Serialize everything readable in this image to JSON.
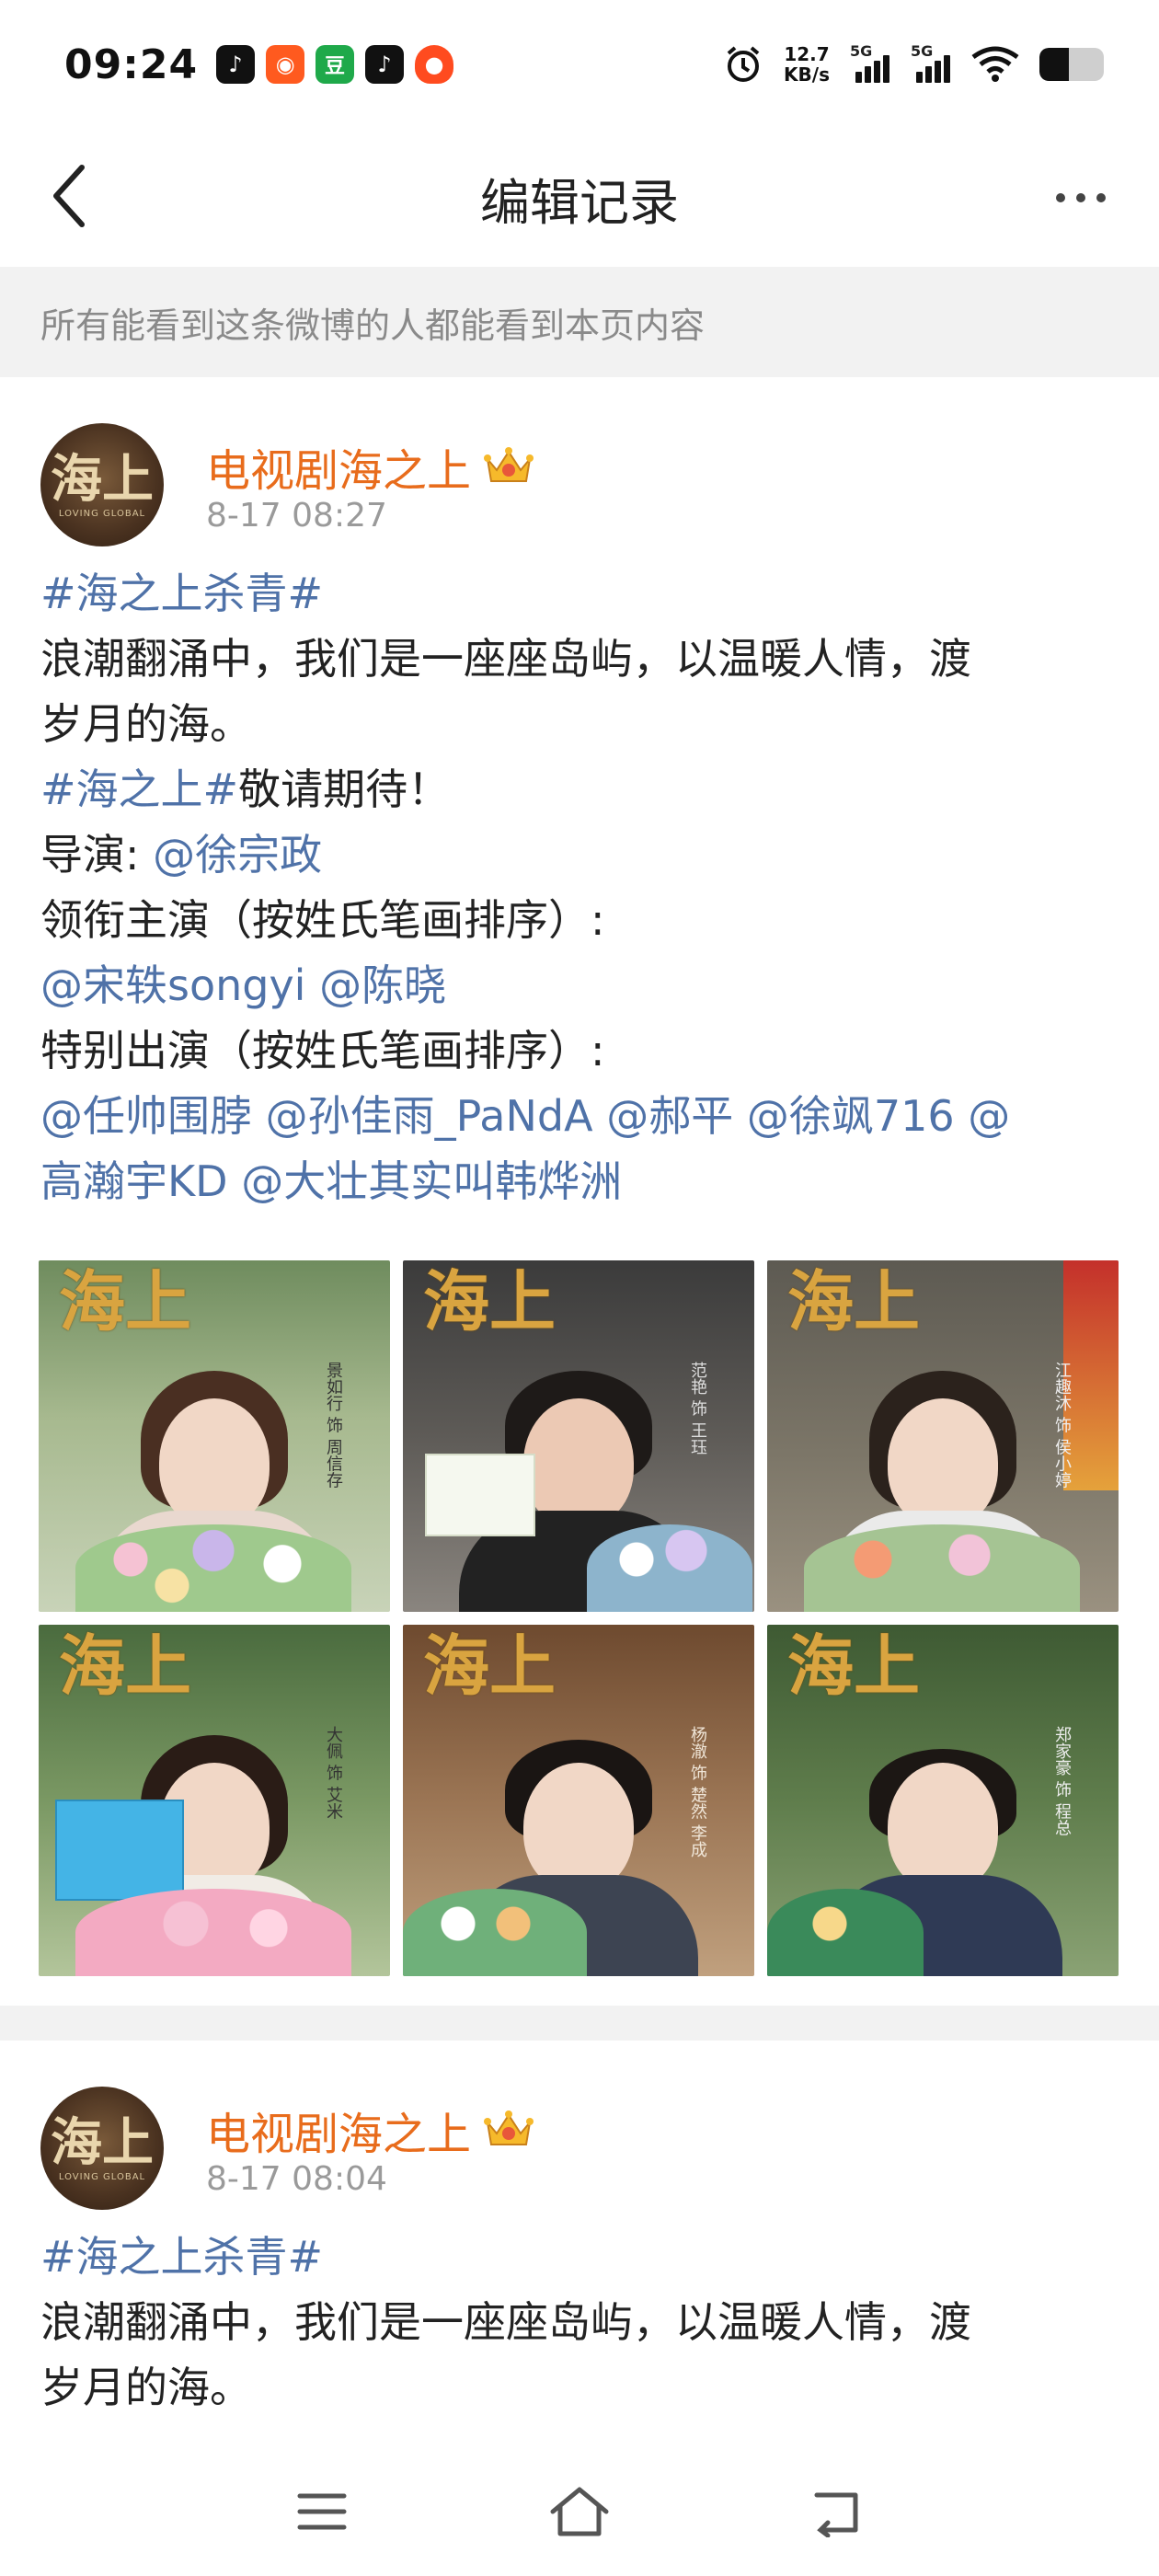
{
  "status_bar": {
    "time": "09:24",
    "net_speed_value": "12.7",
    "net_speed_unit": "KB/s",
    "signal1_label": "5G",
    "signal2_label": "5G",
    "app_icons": [
      "tiktok-lite-icon",
      "kuaishou-icon",
      "douban-icon",
      "tiktok-icon",
      "taobao-icon"
    ],
    "battery_level": 0.45
  },
  "nav": {
    "title": "编辑记录"
  },
  "notice": {
    "text": "所有能看到这条微博的人都能看到本页内容"
  },
  "posts": [
    {
      "author": "电视剧海之上",
      "avatar_text": "海上",
      "avatar_sub": "LOVING GLOBAL",
      "time": "8-17 08:27",
      "lines": [
        [
          {
            "t": "topic",
            "v": "#海之上杀青#"
          }
        ],
        [
          {
            "t": "text",
            "v": "浪潮翻涌中，我们是一座座岛屿，以温暖人情，渡"
          }
        ],
        [
          {
            "t": "text",
            "v": "岁月的海。"
          }
        ],
        [
          {
            "t": "topic",
            "v": "#海之上#"
          },
          {
            "t": "text",
            "v": "敬请期待！"
          }
        ],
        [
          {
            "t": "text",
            "v": "导演: "
          },
          {
            "t": "mention",
            "v": "@徐宗政"
          }
        ],
        [
          {
            "t": "text",
            "v": "领衔主演（按姓氏笔画排序）:"
          }
        ],
        [
          {
            "t": "mention",
            "v": "@宋轶songyi"
          },
          {
            "t": "text",
            "v": " "
          },
          {
            "t": "mention",
            "v": "@陈晓"
          }
        ],
        [
          {
            "t": "text",
            "v": "特别出演（按姓氏笔画排序）:"
          }
        ],
        [
          {
            "t": "mention",
            "v": "@任帅围脖"
          },
          {
            "t": "text",
            "v": " "
          },
          {
            "t": "mention",
            "v": "@孙佳雨_PaNdA"
          },
          {
            "t": "text",
            "v": " "
          },
          {
            "t": "mention",
            "v": "@郝平"
          },
          {
            "t": "text",
            "v": " "
          },
          {
            "t": "mention",
            "v": "@徐飒716"
          },
          {
            "t": "text",
            "v": " "
          },
          {
            "t": "mention",
            "v": "@"
          }
        ],
        [
          {
            "t": "mention",
            "v": "高瀚宇KD"
          },
          {
            "t": "text",
            "v": " "
          },
          {
            "t": "mention",
            "v": "@大壮其实叫韩烨洲"
          }
        ]
      ],
      "images": [
        {
          "logo": "海上",
          "caption": "景如行 饰 周信存"
        },
        {
          "logo": "海上",
          "caption": "范艳 饰 王珏"
        },
        {
          "logo": "海上",
          "caption": "江趣沐 饰 侯小婷"
        },
        {
          "logo": "海上",
          "caption": "大佩 饰 艾米"
        },
        {
          "logo": "海上",
          "caption": "杨澈 饰 楚然 李成"
        },
        {
          "logo": "海上",
          "caption": "郑家豪 饰 程总"
        }
      ]
    },
    {
      "author": "电视剧海之上",
      "avatar_text": "海上",
      "avatar_sub": "LOVING GLOBAL",
      "time": "8-17 08:04",
      "lines": [
        [
          {
            "t": "topic",
            "v": "#海之上杀青#"
          }
        ],
        [
          {
            "t": "text",
            "v": "浪潮翻涌中，我们是一座座岛屿，以温暖人情，渡"
          }
        ],
        [
          {
            "t": "text",
            "v": "岁月的海。"
          }
        ]
      ]
    }
  ],
  "colors": {
    "author": "#e86c1c",
    "link": "#4f72a8",
    "notice_bg": "#f2f2f2",
    "notice_text": "#8a8a8a",
    "timestamp": "#9a9a9a",
    "logo_gold": "#d9a440"
  },
  "icons": {
    "back": "back-arrow-icon",
    "more": "more-dots-icon",
    "crown": "vip-crown-icon",
    "menu": "menu-icon",
    "home": "home-icon",
    "back_nav": "return-icon"
  }
}
